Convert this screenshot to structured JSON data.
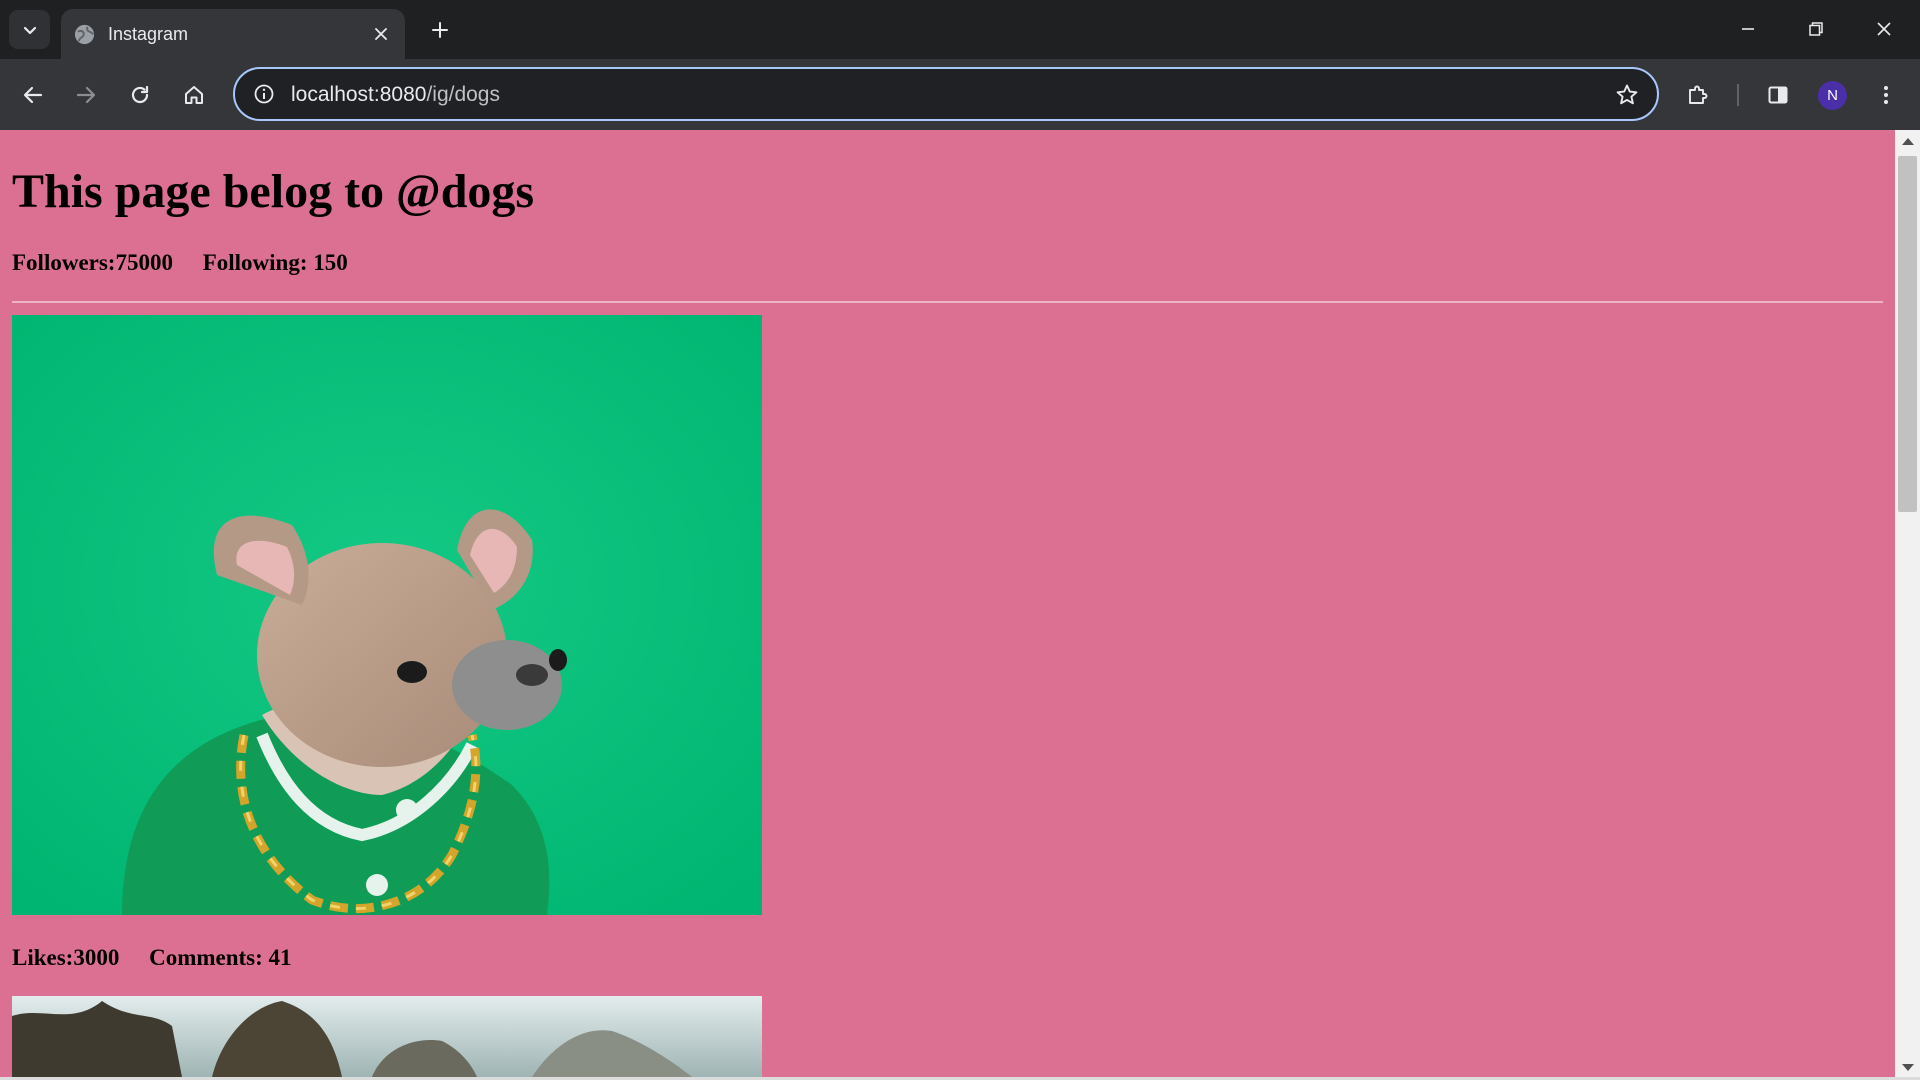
{
  "browser": {
    "tab": {
      "title": "Instagram",
      "favicon": "globe-icon"
    },
    "url": {
      "host": "localhost:8080",
      "path": "/ig/dogs"
    },
    "profile_initial": "N",
    "icons": {
      "tab_search": "chevron-down-icon",
      "tab_close": "close-icon",
      "new_tab": "plus-icon",
      "minimize": "minimize-icon",
      "restore": "restore-icon",
      "close_window": "close-icon",
      "back": "back-arrow-icon",
      "forward": "forward-arrow-icon",
      "reload": "reload-icon",
      "home": "home-icon",
      "site_info": "info-icon",
      "bookmark": "star-icon",
      "extensions": "puzzle-icon",
      "side_panel": "side-panel-icon",
      "menu": "kebab-menu-icon"
    }
  },
  "page": {
    "heading": "This page belog to @dogs",
    "followers": "Followers:75000",
    "following": "Following: 150",
    "colors": {
      "background": "#dc7093",
      "post_backdrop": "#00c081"
    },
    "posts": [
      {
        "image": "french-bulldog-in-green-jacket-with-gold-chain",
        "likes": "Likes:3000",
        "comments": "Comments: 41"
      },
      {
        "image": "outdoor-trees-sky-photo"
      }
    ]
  }
}
